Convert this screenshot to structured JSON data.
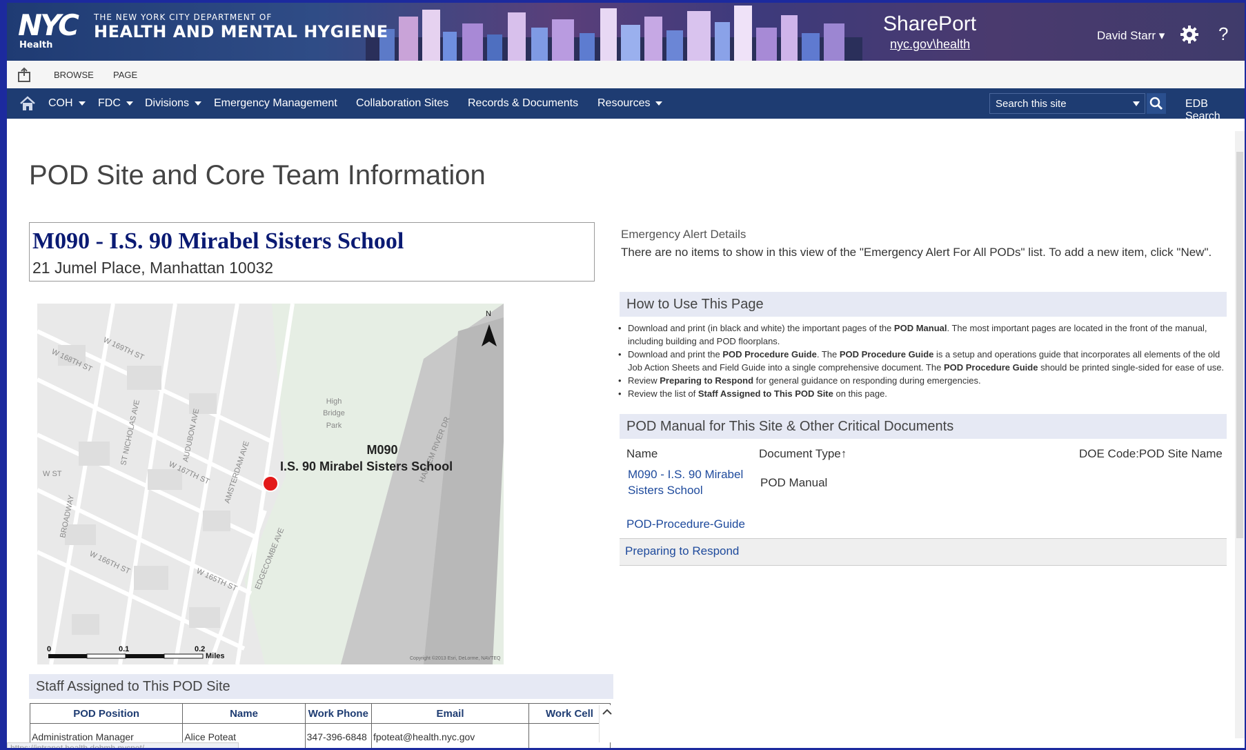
{
  "banner": {
    "logo_text": "NYC",
    "logo_sub": "Health",
    "dept_line1": "THE NEW YORK CITY DEPARTMENT OF",
    "dept_line2": "HEALTH AND MENTAL HYGIENE",
    "app_title": "SharePort",
    "app_link": "nyc.gov\\health",
    "user": "David Starr ▾",
    "help": "?"
  },
  "ribbon": {
    "tabs": [
      "BROWSE",
      "PAGE"
    ]
  },
  "nav": {
    "items": [
      {
        "label": "COH",
        "has_caret": true
      },
      {
        "label": "FDC",
        "has_caret": true
      },
      {
        "label": "Divisions",
        "has_caret": true
      },
      {
        "label": "Emergency Management",
        "has_caret": false
      },
      {
        "label": "Collaboration Sites",
        "has_caret": false
      },
      {
        "label": "Records & Documents",
        "has_caret": false
      },
      {
        "label": "Resources",
        "has_caret": true
      }
    ],
    "search_placeholder": "Search this site",
    "edb_search": "EDB Search"
  },
  "page": {
    "title": "POD Site and Core Team Information",
    "site_name": "M090 - I.S. 90 Mirabel Sisters School",
    "site_address": "21 Jumel Place, Manhattan 10032"
  },
  "map": {
    "marker_code": "M090",
    "marker_name": "I.S. 90 Mirabel Sisters School",
    "park_label_1": "High",
    "park_label_2": "Bridge",
    "park_label_3": "Park",
    "streets": [
      "W 169TH ST",
      "W 168TH ST",
      "W 167TH ST",
      "W 166TH ST",
      "W 165TH ST",
      "ST NICHOLAS AVE",
      "AUDUBON AVE",
      "AMSTERDAM AVE",
      "EDGECOMBE AVE",
      "BROADWAY",
      "HARLEM RIVER DR",
      "W ST"
    ],
    "north": "N",
    "scale_0": "0",
    "scale_1": "0.1",
    "scale_2": "0.2",
    "scale_unit": "Miles",
    "copyright": "Copyright ©2013 Esri, DeLorme, NAVTEQ"
  },
  "alert": {
    "title": "Emergency Alert Details",
    "text": "There are no items to show in this view of the \"Emergency Alert For All PODs\" list. To add a new item, click \"New\"."
  },
  "howto": {
    "title": "How to Use This Page",
    "items": [
      {
        "parts": [
          "Download and print (in black and white) the important pages of the ",
          "POD Manual",
          ". The most important pages are located in the front of the manual, including building and POD floorplans."
        ]
      },
      {
        "parts": [
          "Download and print the ",
          "POD Procedure Guide",
          ". The ",
          "POD Procedure Guide",
          " is a setup and operations guide that incorporates all elements of the old Job Action Sheets and Field Guide into a single comprehensive document. The ",
          "POD Procedure Guide",
          " should be printed single-sided for ease of use."
        ]
      },
      {
        "parts": [
          "Review ",
          "Preparing to Respond",
          " for general guidance on responding during emergencies."
        ]
      },
      {
        "parts": [
          "Review the list of ",
          "Staff Assigned to This POD Site",
          " on this page."
        ]
      }
    ]
  },
  "docs": {
    "title": "POD Manual for This Site & Other Critical Documents",
    "col_name": "Name",
    "col_type": "Document Type↑",
    "col_site": "DOE Code:POD Site Name",
    "row1_name_1": "M090 - I.S. 90 Mirabel",
    "row1_name_2": "Sisters School",
    "row1_type": "POD Manual",
    "row2_name": "POD-Procedure-Guide",
    "prep": "Preparing to Respond"
  },
  "staff": {
    "title": "Staff Assigned to This POD Site",
    "columns": [
      "POD Position",
      "Name",
      "Work Phone",
      "Email",
      "Work Cell"
    ],
    "rows": [
      {
        "position": "Administration Manager",
        "name": "Alice Poteat",
        "phone": "347-396-6848",
        "email": "fpoteat@health.nyc.gov",
        "cell": ""
      }
    ]
  },
  "status_url": "https://intranet.health.dohmh.nycnet/"
}
